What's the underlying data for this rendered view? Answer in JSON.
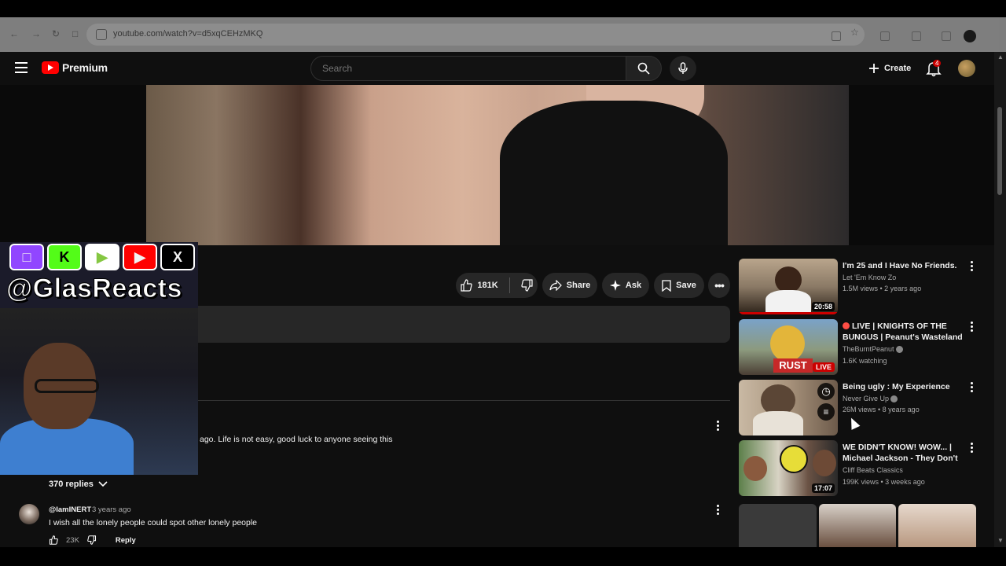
{
  "browser": {
    "url": "youtube.com/watch?v=d5xqCEHzMKQ"
  },
  "header": {
    "logo_text": "Premium",
    "search_placeholder": "Search",
    "create_label": "Create",
    "notification_count": "4"
  },
  "overlay": {
    "handle": "@GlasReacts",
    "socials": [
      "twitch-icon",
      "kick-icon",
      "rumble-icon",
      "youtube-icon",
      "x-icon"
    ]
  },
  "actions": {
    "likes": "181K",
    "share": "Share",
    "ask": "Ask",
    "save": "Save"
  },
  "comments": {
    "first_text": "ago. Life is not easy, good luck to anyone seeing this",
    "replies_label": "370 replies",
    "second": {
      "author": "@IamINERT",
      "time": "3 years ago",
      "text": "I wish all the lonely people could spot other lonely people",
      "likes": "23K",
      "reply": "Reply"
    }
  },
  "recommendations": [
    {
      "title": "I'm 25 and I Have No Friends.",
      "channel": "Let 'Em Know Zo",
      "meta": "1.5M views • 2 years ago",
      "duration": "20:58"
    },
    {
      "title": "LIVE | KNIGHTS OF THE BUNGUS | Peanut's Wasteland ...",
      "channel": "TheBurntPeanut",
      "meta": "1.6K watching",
      "badge": "LIVE"
    },
    {
      "title": "Being ugly : My Experience",
      "channel": "Never Give Up",
      "meta": "26M views • 8 years ago"
    },
    {
      "title": "WE DIDN'T KNOW! WOW... | Michael Jackson - They Don't ...",
      "channel": "Cliff Beats Classics",
      "meta": "199K views • 3 weeks ago",
      "duration": "17:07"
    }
  ],
  "colors": {
    "background": "#0f0f0f",
    "brand_red": "#ff0000",
    "button_bg": "#272727"
  }
}
